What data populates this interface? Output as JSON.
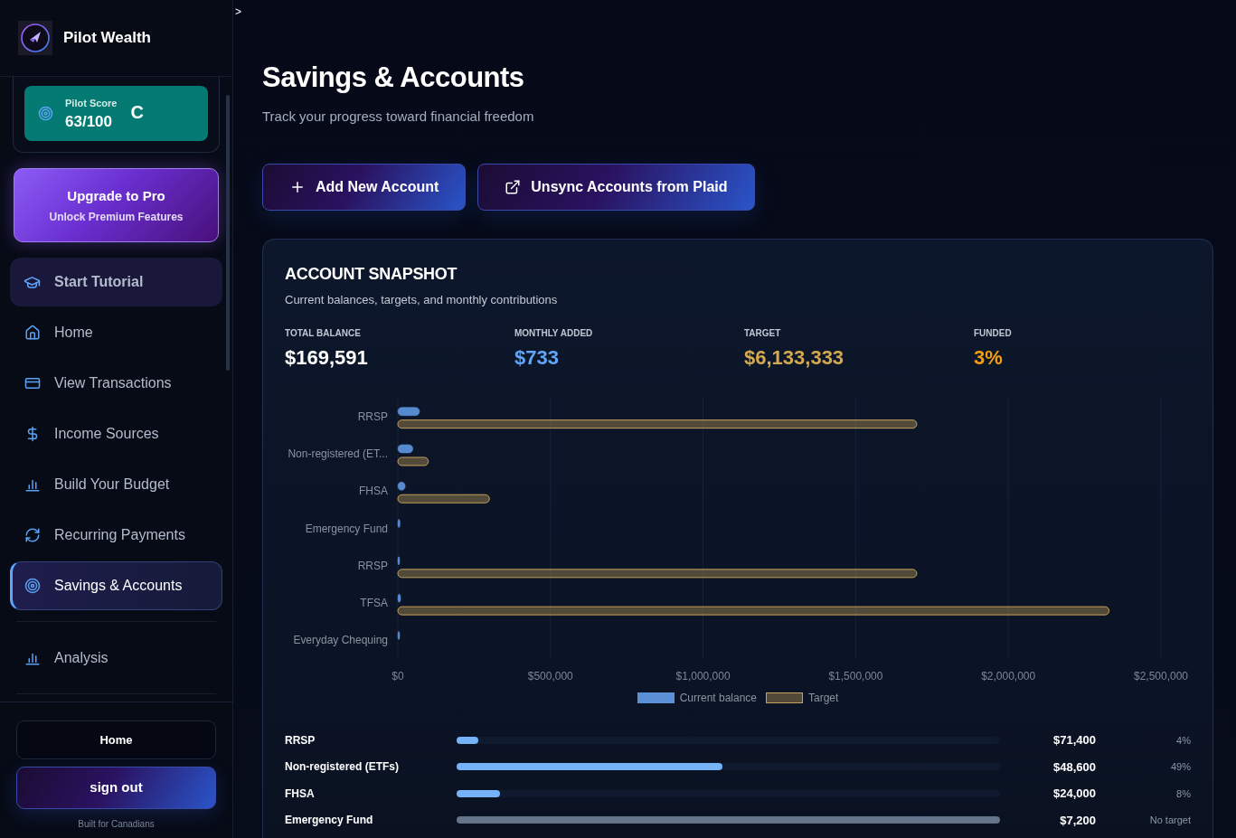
{
  "sidebar": {
    "brand": "Pilot Wealth",
    "score": {
      "label": "Pilot Score",
      "value": "63/100",
      "grade": "C"
    },
    "upgrade": {
      "title": "Upgrade to Pro",
      "subtitle": "Unlock Premium Features"
    },
    "tutorial": {
      "label": "Start Tutorial"
    },
    "nav_groups": [
      {
        "items": [
          {
            "label": "Home",
            "kind": "home",
            "selected": false
          },
          {
            "label": "View Transactions",
            "kind": "transactions",
            "selected": false
          },
          {
            "label": "Income Sources",
            "kind": "income",
            "selected": false
          },
          {
            "label": "Build Your Budget",
            "kind": "budget",
            "selected": false
          },
          {
            "label": "Recurring Payments",
            "kind": "recurring",
            "selected": false
          },
          {
            "label": "Savings & Accounts",
            "kind": "savings",
            "selected": true
          }
        ]
      },
      {
        "items": [
          {
            "label": "Analysis",
            "kind": "analysis",
            "selected": false
          }
        ]
      }
    ],
    "footer": {
      "buttons": [
        {
          "label": "Home",
          "kind": "outline"
        },
        {
          "label": "sign out",
          "kind": "gradient"
        }
      ],
      "note": "Built for Canadians"
    }
  },
  "main": {
    "marker": ">",
    "title": "Savings & Accounts",
    "subtitle": "Track your progress toward financial freedom",
    "actions": [
      {
        "label": "Add New Account",
        "kind": "add"
      },
      {
        "label": "Unsync Accounts from Plaid",
        "kind": "external"
      }
    ]
  },
  "snapshot": {
    "title": "ACCOUNT SNAPSHOT",
    "subtitle": "Current balances, targets, and monthly contributions",
    "stats": [
      {
        "label": "TOTAL BALANCE",
        "value": "$169,591",
        "color": "#ffffff"
      },
      {
        "label": "MONTHLY ADDED",
        "value": "$733",
        "color": "#60a5fa"
      },
      {
        "label": "TARGET",
        "value": "$6,133,333",
        "color": "#d4a94f"
      },
      {
        "label": "FUNDED",
        "value": "3%",
        "color": "#f59e0b"
      }
    ],
    "chart_data": {
      "type": "bar",
      "orientation": "horizontal",
      "grid": true,
      "legend": "bottom",
      "categories": [
        "RRSP",
        "Non-registered (ET...",
        "FHSA",
        "Emergency Fund",
        "RRSP",
        "TFSA",
        "Everyday Chequing"
      ],
      "series": [
        {
          "name": "Current balance",
          "color": "#5b8fd6",
          "values": [
            71000,
            49000,
            24000,
            7000,
            4000,
            9000,
            5000
          ]
        },
        {
          "name": "Target",
          "color": "#c9a25a",
          "values": [
            1700000,
            100000,
            300000,
            0,
            1700000,
            2330000,
            0
          ]
        }
      ],
      "xlim": [
        0,
        2500000
      ],
      "xticks": [
        {
          "value": 0,
          "label": "$0"
        },
        {
          "value": 500000,
          "label": "$500,000"
        },
        {
          "value": 1000000,
          "label": "$1,000,000"
        },
        {
          "value": 1500000,
          "label": "$1,500,000"
        },
        {
          "value": 2000000,
          "label": "$2,000,000"
        },
        {
          "value": 2500000,
          "label": "$2,500,000"
        }
      ]
    },
    "accounts": [
      {
        "name": "RRSP",
        "level": 0.04,
        "has_target": true,
        "amount": "$71,400",
        "percent": "4%"
      },
      {
        "name": "Non-registered (ETFs)",
        "level": 0.49,
        "has_target": true,
        "amount": "$48,600",
        "percent": "49%"
      },
      {
        "name": "FHSA",
        "level": 0.08,
        "has_target": true,
        "amount": "$24,000",
        "percent": "8%"
      },
      {
        "name": "Emergency Fund",
        "has_target": false,
        "amount": "$7,200",
        "percent": "No target"
      }
    ]
  }
}
